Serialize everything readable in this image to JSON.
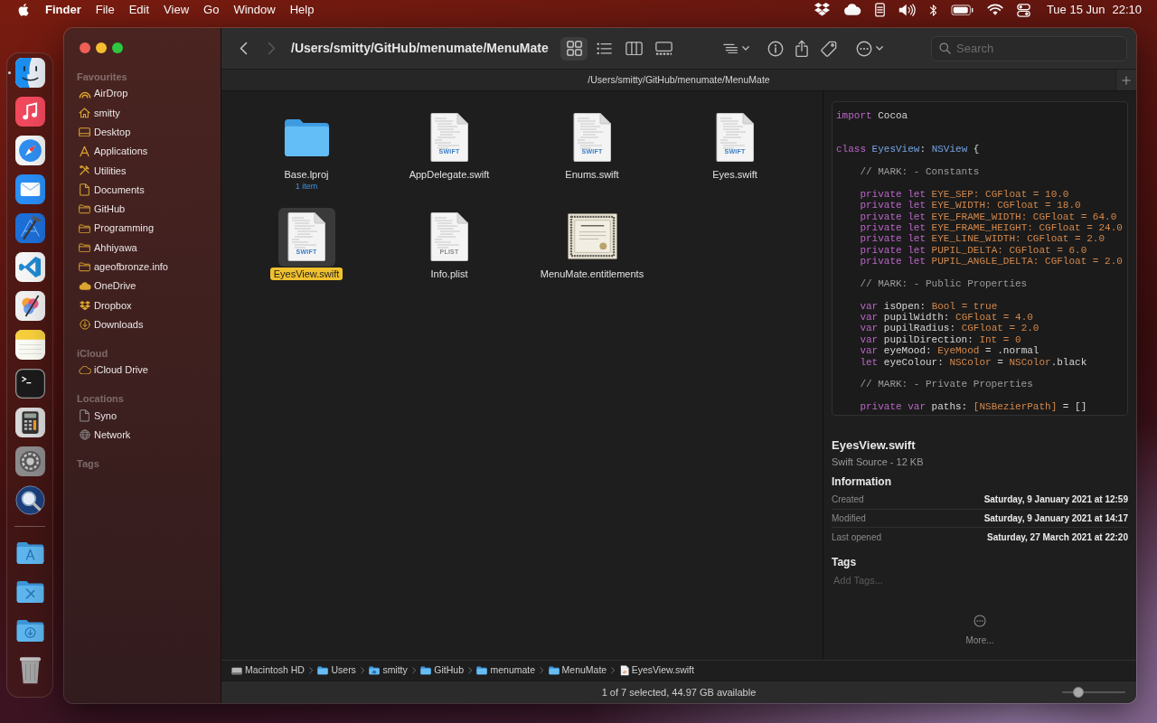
{
  "menu_bar": {
    "menus": [
      {
        "label": "Finder",
        "kind": "app"
      },
      {
        "label": "File",
        "kind": "menu"
      },
      {
        "label": "Edit",
        "kind": "menu"
      },
      {
        "label": "View",
        "kind": "menu"
      },
      {
        "label": "Go",
        "kind": "menu"
      },
      {
        "label": "Window",
        "kind": "menu"
      },
      {
        "label": "Help",
        "kind": "menu"
      }
    ],
    "status_icons": [
      {
        "kind": "dropbox"
      },
      {
        "kind": "cloud"
      },
      {
        "kind": "storage"
      },
      {
        "kind": "volume"
      },
      {
        "kind": "bluetooth"
      },
      {
        "kind": "battery"
      },
      {
        "kind": "wifi"
      },
      {
        "kind": "control_center"
      }
    ],
    "date": "Tue 15 Jun",
    "time": "22:10"
  },
  "dock": {
    "apps": [
      {
        "kind": "finder",
        "running": true
      },
      {
        "kind": "music",
        "running": false
      },
      {
        "kind": "safari",
        "running": false
      },
      {
        "kind": "mail",
        "running": false
      },
      {
        "kind": "xcode",
        "running": false
      },
      {
        "kind": "vscode",
        "running": false
      },
      {
        "kind": "pixelmator",
        "running": false
      },
      {
        "kind": "notes",
        "running": false
      },
      {
        "kind": "terminal",
        "running": false
      },
      {
        "kind": "calculator",
        "running": false
      },
      {
        "kind": "settings",
        "running": false
      },
      {
        "kind": "magnifier",
        "running": false
      }
    ],
    "stacks": [
      {
        "kind": "applications"
      },
      {
        "kind": "utilities"
      },
      {
        "kind": "downloads"
      },
      {
        "kind": "trash"
      }
    ]
  },
  "window": {
    "toolbar": {
      "nav": [
        {
          "kind": "back",
          "disabled": false
        },
        {
          "kind": "forward",
          "disabled": true
        }
      ],
      "title": "/Users/smitty/GitHub/menumate/MenuMate",
      "view_modes": [
        {
          "kind": "icons",
          "selected": true
        },
        {
          "kind": "list",
          "selected": false
        },
        {
          "kind": "columns",
          "selected": false
        },
        {
          "kind": "gallery",
          "selected": false
        }
      ],
      "actions": [
        {
          "kind": "group",
          "has_menu": true
        },
        {
          "kind": "info",
          "has_menu": false
        },
        {
          "kind": "share",
          "has_menu": false
        },
        {
          "kind": "tag",
          "has_menu": false
        },
        {
          "kind": "more",
          "has_menu": true
        }
      ],
      "search": {
        "placeholder": "Search"
      }
    },
    "tab_bar": {
      "title": "/Users/smitty/GitHub/menumate/MenuMate"
    },
    "sidebar": {
      "sections": [
        {
          "heading": "Favourites",
          "items": [
            {
              "label": "AirDrop",
              "kind": "airdrop",
              "selected": false
            },
            {
              "label": "smitty",
              "kind": "home",
              "selected": false
            },
            {
              "label": "Desktop",
              "kind": "desktop",
              "selected": false
            },
            {
              "label": "Applications",
              "kind": "applications",
              "selected": false
            },
            {
              "label": "Utilities",
              "kind": "utilities",
              "selected": false
            },
            {
              "label": "Documents",
              "kind": "documents",
              "selected": false
            },
            {
              "label": "GitHub",
              "kind": "folder",
              "selected": false
            },
            {
              "label": "Programming",
              "kind": "folder",
              "selected": false
            },
            {
              "label": "Ahhiyawa",
              "kind": "folder",
              "selected": false
            },
            {
              "label": "ageofbronze.info",
              "kind": "folder",
              "selected": false
            },
            {
              "label": "OneDrive",
              "kind": "onedrive",
              "selected": false
            },
            {
              "label": "Dropbox",
              "kind": "dropbox",
              "selected": false
            },
            {
              "label": "Downloads",
              "kind": "downloads",
              "selected": false
            }
          ]
        },
        {
          "heading": "iCloud",
          "items": [
            {
              "label": "iCloud Drive",
              "kind": "icloud",
              "selected": false
            }
          ]
        },
        {
          "heading": "Locations",
          "items": [
            {
              "label": "Syno",
              "kind": "server",
              "selected": false
            },
            {
              "label": "Network",
              "kind": "network",
              "selected": false
            }
          ]
        },
        {
          "heading": "Tags"
        }
      ]
    },
    "files": [
      {
        "name": "Base.lproj",
        "kind": "folder",
        "detail": "1 item",
        "selected": false
      },
      {
        "name": "AppDelegate.swift",
        "kind": "swift_doc",
        "type_label": "SWIFT",
        "selected": false
      },
      {
        "name": "Enums.swift",
        "kind": "swift_doc",
        "type_label": "SWIFT",
        "selected": false
      },
      {
        "name": "Eyes.swift",
        "kind": "swift_doc",
        "type_label": "SWIFT",
        "selected": false
      },
      {
        "name": "EyesView.swift",
        "kind": "swift_doc",
        "type_label": "SWIFT",
        "selected": true
      },
      {
        "name": "Info.plist",
        "kind": "plist_doc",
        "type_label": "PLIST",
        "selected": false
      },
      {
        "name": "MenuMate.entitlements",
        "kind": "certificate",
        "selected": false
      }
    ],
    "preview": {
      "code": {
        "lines": [
          {
            "kind": "code",
            "tokens": [
              {
                "text": "import",
                "kind": "keyword"
              },
              {
                "text": " Cocoa",
                "kind": "plain"
              }
            ]
          },
          {
            "kind": "blank"
          },
          {
            "kind": "blank"
          },
          {
            "kind": "code",
            "tokens": [
              {
                "text": "class",
                "kind": "keyword"
              },
              {
                "text": " EyesView",
                "kind": "type"
              },
              {
                "text": ": ",
                "kind": "plain"
              },
              {
                "text": "NSView",
                "kind": "type"
              },
              {
                "text": " {",
                "kind": "plain"
              }
            ],
            "children": [
              {
                "kind": "blank"
              },
              {
                "kind": "code",
                "tokens": [
                  {
                    "text": "// MARK: - Constants",
                    "kind": "comment"
                  }
                ]
              },
              {
                "kind": "blank"
              },
              {
                "kind": "code",
                "tokens": [
                  {
                    "text": "private let",
                    "kind": "keyword"
                  },
                  {
                    "text": " EYE_SEP: CGFloat = 10.0",
                    "kind": "literal"
                  }
                ]
              },
              {
                "kind": "code",
                "tokens": [
                  {
                    "text": "private let",
                    "kind": "keyword"
                  },
                  {
                    "text": " EYE_WIDTH: CGFloat = 18.0",
                    "kind": "literal"
                  }
                ]
              },
              {
                "kind": "code",
                "tokens": [
                  {
                    "text": "private let",
                    "kind": "keyword"
                  },
                  {
                    "text": " EYE_FRAME_WIDTH: CGFloat = 64.0",
                    "kind": "literal"
                  }
                ]
              },
              {
                "kind": "code",
                "tokens": [
                  {
                    "text": "private let",
                    "kind": "keyword"
                  },
                  {
                    "text": " EYE_FRAME_HEIGHT: CGFloat = 24.0",
                    "kind": "literal"
                  }
                ]
              },
              {
                "kind": "code",
                "tokens": [
                  {
                    "text": "private let",
                    "kind": "keyword"
                  },
                  {
                    "text": " EYE_LINE_WIDTH: CGFloat = 2.0",
                    "kind": "literal"
                  }
                ]
              },
              {
                "kind": "code",
                "tokens": [
                  {
                    "text": "private let",
                    "kind": "keyword"
                  },
                  {
                    "text": " PUPIL_DELTA: CGFloat = 6.0",
                    "kind": "literal"
                  }
                ]
              },
              {
                "kind": "code",
                "tokens": [
                  {
                    "text": "private let",
                    "kind": "keyword"
                  },
                  {
                    "text": " PUPIL_ANGLE_DELTA: CGFloat = 2.0",
                    "kind": "literal"
                  }
                ]
              },
              {
                "kind": "blank"
              },
              {
                "kind": "code",
                "tokens": [
                  {
                    "text": "// MARK: - Public Properties",
                    "kind": "comment"
                  }
                ]
              },
              {
                "kind": "blank"
              },
              {
                "kind": "code",
                "tokens": [
                  {
                    "text": "var",
                    "kind": "keyword"
                  },
                  {
                    "text": " isOpen: ",
                    "kind": "plain"
                  },
                  {
                    "text": "Bool = true",
                    "kind": "literal"
                  }
                ]
              },
              {
                "kind": "code",
                "tokens": [
                  {
                    "text": "var",
                    "kind": "keyword"
                  },
                  {
                    "text": " pupilWidth: ",
                    "kind": "plain"
                  },
                  {
                    "text": "CGFloat = 4.0",
                    "kind": "literal"
                  }
                ]
              },
              {
                "kind": "code",
                "tokens": [
                  {
                    "text": "var",
                    "kind": "keyword"
                  },
                  {
                    "text": " pupilRadius: ",
                    "kind": "plain"
                  },
                  {
                    "text": "CGFloat = 2.0",
                    "kind": "literal"
                  }
                ]
              },
              {
                "kind": "code",
                "tokens": [
                  {
                    "text": "var",
                    "kind": "keyword"
                  },
                  {
                    "text": " pupilDirection: ",
                    "kind": "plain"
                  },
                  {
                    "text": "Int = 0",
                    "kind": "literal"
                  }
                ]
              },
              {
                "kind": "code",
                "tokens": [
                  {
                    "text": "var",
                    "kind": "keyword"
                  },
                  {
                    "text": " eyeMood: ",
                    "kind": "plain"
                  },
                  {
                    "text": "EyeMood",
                    "kind": "literal"
                  },
                  {
                    "text": " = .normal",
                    "kind": "plain"
                  }
                ]
              },
              {
                "kind": "code",
                "tokens": [
                  {
                    "text": "let",
                    "kind": "keyword"
                  },
                  {
                    "text": " eyeColour: ",
                    "kind": "plain"
                  },
                  {
                    "text": "NSColor",
                    "kind": "literal"
                  },
                  {
                    "text": " = ",
                    "kind": "plain"
                  },
                  {
                    "text": "NSColor",
                    "kind": "literal"
                  },
                  {
                    "text": ".black",
                    "kind": "plain"
                  }
                ]
              },
              {
                "kind": "blank"
              },
              {
                "kind": "code",
                "tokens": [
                  {
                    "text": "// MARK: - Private Properties",
                    "kind": "comment"
                  }
                ]
              },
              {
                "kind": "blank"
              },
              {
                "kind": "code",
                "tokens": [
                  {
                    "text": "private var",
                    "kind": "keyword"
                  },
                  {
                    "text": " paths: ",
                    "kind": "plain"
                  },
                  {
                    "text": "[NSBezierPath]",
                    "kind": "literal"
                  },
                  {
                    "text": " = []",
                    "kind": "plain"
                  }
                ]
              }
            ]
          }
        ]
      },
      "name": "EyesView.swift",
      "subtitle": "Swift Source - 12 KB",
      "info_heading": "Information",
      "info": [
        {
          "label": "Created",
          "value": "Saturday, 9 January 2021 at 12:59"
        },
        {
          "label": "Modified",
          "value": "Saturday, 9 January 2021 at 14:17"
        },
        {
          "label": "Last opened",
          "value": "Saturday, 27 March 2021 at 22:20"
        }
      ],
      "tags_heading": "Tags",
      "tags_field": {
        "placeholder": "Add Tags..."
      },
      "more_label": "More..."
    },
    "path_bar": [
      {
        "label": "Macintosh HD",
        "kind": "disk"
      },
      {
        "label": "Users",
        "kind": "folder"
      },
      {
        "label": "smitty",
        "kind": "home"
      },
      {
        "label": "GitHub",
        "kind": "folder"
      },
      {
        "label": "menumate",
        "kind": "folder"
      },
      {
        "label": "MenuMate",
        "kind": "folder"
      },
      {
        "label": "EyesView.swift",
        "kind": "file"
      }
    ],
    "status_bar": {
      "text": "1 of 7 selected, 44.97 GB available",
      "icon_size": {
        "level": 0.2
      }
    }
  }
}
